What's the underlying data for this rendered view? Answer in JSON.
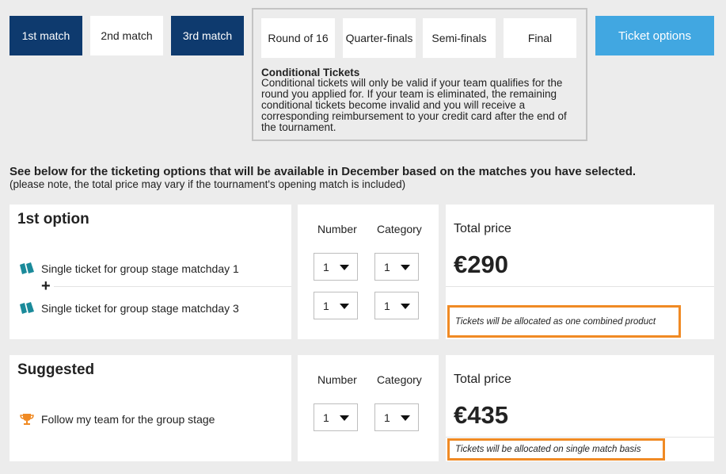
{
  "match_tabs": [
    {
      "label": "1st match"
    },
    {
      "label": "2nd match"
    },
    {
      "label": "3rd match"
    }
  ],
  "rounds": [
    {
      "label": "Round of 16"
    },
    {
      "label": "Quarter-finals"
    },
    {
      "label": "Semi-finals"
    },
    {
      "label": "Final"
    }
  ],
  "conditional": {
    "title": "Conditional Tickets",
    "text": "Conditional tickets will only be valid if your team qualifies for the round you applied for. If your team is eliminated, the remaining conditional tickets become invalid and you will receive a corresponding reimbursement to your credit card after the end of the tournament."
  },
  "ticket_options_button": "Ticket options",
  "headline": "See below for the ticketing options that will be available in December based on the matches you have selected.",
  "subline": "(please note, the total price may vary if the tournament's opening match is included)",
  "columns": {
    "number": "Number",
    "category": "Category"
  },
  "total_price_label": "Total price",
  "options": [
    {
      "title": "1st option",
      "items": [
        {
          "label": "Single ticket for group stage matchday 1",
          "icon": "ticket-icon",
          "number": "1",
          "category": "1"
        },
        {
          "label": "Single ticket for group stage matchday 3",
          "icon": "ticket-icon",
          "number": "1",
          "category": "1"
        }
      ],
      "plus": "+",
      "price": "€290",
      "allocation": "Tickets will be allocated as one combined product"
    },
    {
      "title": "Suggested",
      "items": [
        {
          "label": "Follow my team for the group stage",
          "icon": "trophy-icon",
          "number": "1",
          "category": "1"
        }
      ],
      "price": "€435",
      "allocation": "Tickets will be allocated on single match basis"
    }
  ],
  "colors": {
    "navy": "#0e3a6e",
    "sky": "#41a7e1",
    "teal": "#1a8a9a",
    "orange": "#f08a24"
  }
}
